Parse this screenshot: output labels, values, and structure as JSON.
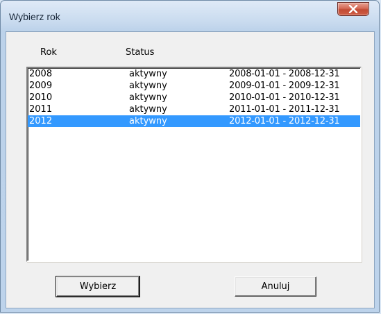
{
  "window": {
    "title": "Wybierz rok",
    "close_label": "X"
  },
  "list": {
    "headers": {
      "year": "Rok",
      "status": "Status"
    },
    "rows": [
      {
        "year": "2008",
        "status": "aktywny",
        "range": "2008-01-01 - 2008-12-31"
      },
      {
        "year": "2009",
        "status": "aktywny",
        "range": "2009-01-01 - 2009-12-31"
      },
      {
        "year": "2010",
        "status": "aktywny",
        "range": "2010-01-01 - 2010-12-31"
      },
      {
        "year": "2011",
        "status": "aktywny",
        "range": "2011-01-01 - 2011-12-31"
      },
      {
        "year": "2012",
        "status": "aktywny",
        "range": "2012-01-01 - 2012-12-31"
      }
    ],
    "selected_index": 4
  },
  "buttons": {
    "select_label": "Wybierz",
    "cancel_label": "Anuluj"
  },
  "colors": {
    "selection": "#3399ff",
    "close_button": "#c9503a"
  }
}
